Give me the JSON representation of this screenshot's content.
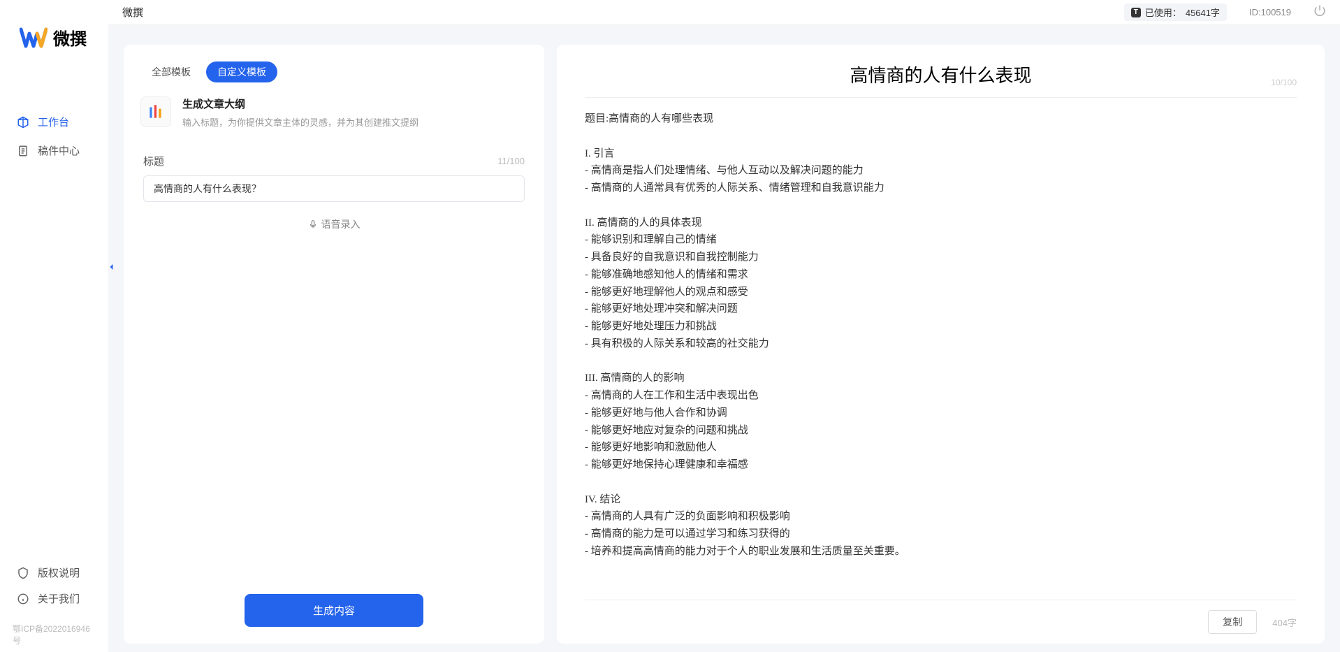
{
  "app": {
    "name": "微撰",
    "logo_text": "微撰"
  },
  "sidebar": {
    "items": [
      {
        "label": "工作台",
        "icon": "cube",
        "active": true
      },
      {
        "label": "稿件中心",
        "icon": "document",
        "active": false
      }
    ],
    "bottom": [
      {
        "label": "版权说明",
        "icon": "shield"
      },
      {
        "label": "关于我们",
        "icon": "info"
      }
    ],
    "icp": "鄂ICP备2022016946号"
  },
  "header": {
    "title": "微撰",
    "usage_label": "已使用：",
    "usage_value": "45641字",
    "id_label": "ID:100519"
  },
  "left_panel": {
    "tabs": [
      {
        "label": "全部模板",
        "active": false
      },
      {
        "label": "自定义模板",
        "active": true
      }
    ],
    "template": {
      "title": "生成文章大纲",
      "desc": "输入标题，为你提供文章主体的灵感，并为其创建推文提纲"
    },
    "form": {
      "label": "标题",
      "count": "11/100",
      "value": "高情商的人有什么表现？",
      "voice": "语音录入"
    },
    "generate_btn": "生成内容"
  },
  "right_panel": {
    "title": "高情商的人有什么表现",
    "title_count": "10/100",
    "body": "题目:高情商的人有哪些表现\n\nI. 引言\n- 高情商是指人们处理情绪、与他人互动以及解决问题的能力\n- 高情商的人通常具有优秀的人际关系、情绪管理和自我意识能力\n\nII. 高情商的人的具体表现\n- 能够识别和理解自己的情绪\n- 具备良好的自我意识和自我控制能力\n- 能够准确地感知他人的情绪和需求\n- 能够更好地理解他人的观点和感受\n- 能够更好地处理冲突和解决问题\n- 能够更好地处理压力和挑战\n- 具有积极的人际关系和较高的社交能力\n\nIII. 高情商的人的影响\n- 高情商的人在工作和生活中表现出色\n- 能够更好地与他人合作和协调\n- 能够更好地应对复杂的问题和挑战\n- 能够更好地影响和激励他人\n- 能够更好地保持心理健康和幸福感\n\nIV. 结论\n- 高情商的人具有广泛的负面影响和积极影响\n- 高情商的能力是可以通过学习和练习获得的\n- 培养和提高高情商的能力对于个人的职业发展和生活质量至关重要。",
    "copy_btn": "复制",
    "char_count": "404字"
  }
}
